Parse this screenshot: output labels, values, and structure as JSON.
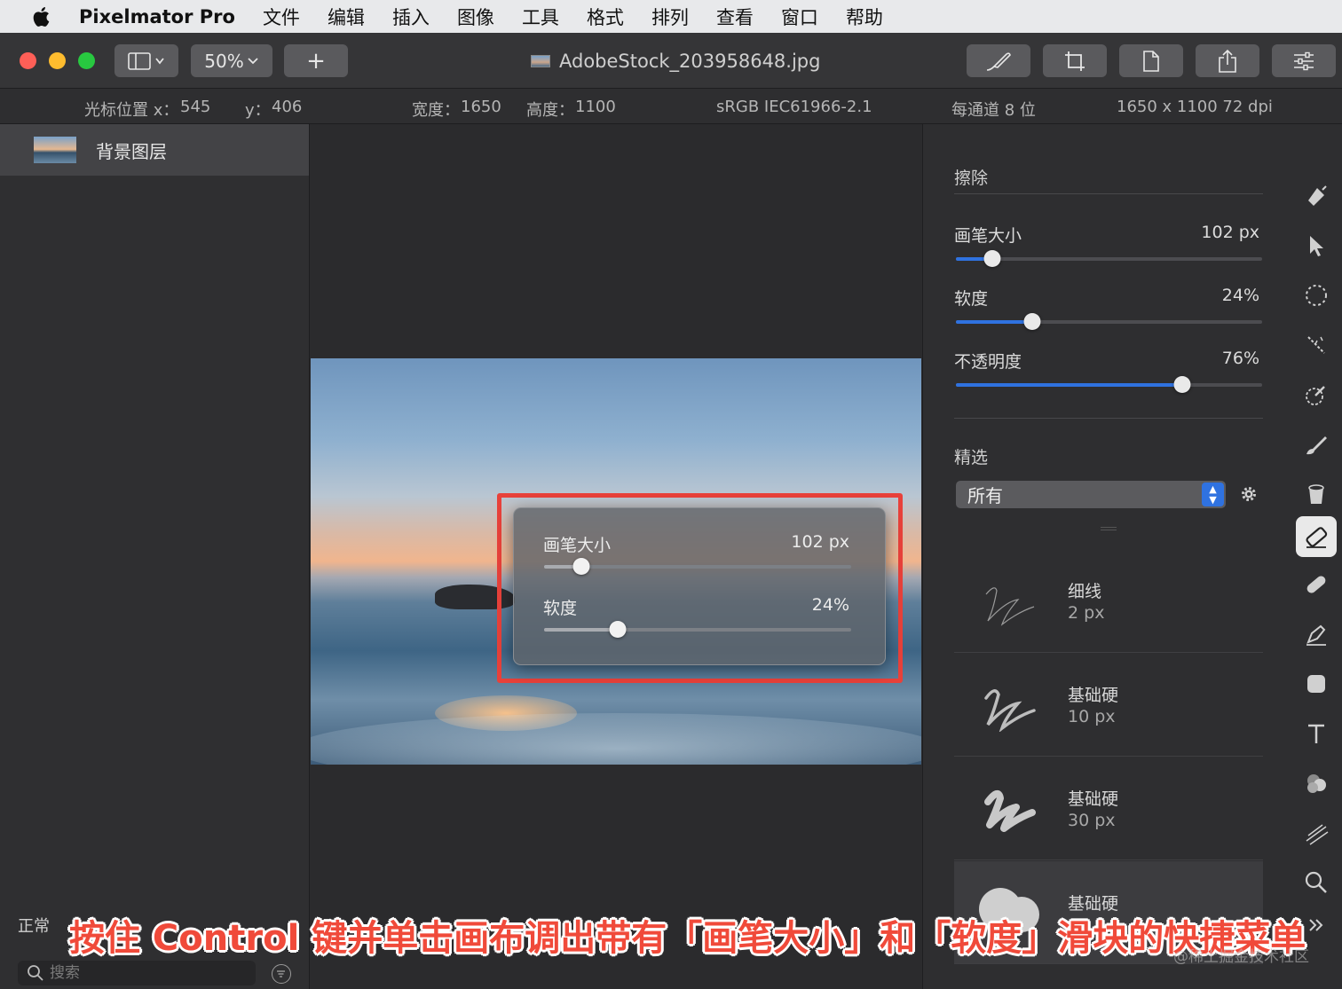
{
  "menubar": {
    "app_name": "Pixelmator Pro",
    "items": [
      "文件",
      "编辑",
      "插入",
      "图像",
      "工具",
      "格式",
      "排列",
      "查看",
      "窗口",
      "帮助"
    ]
  },
  "toolbar": {
    "zoom": "50%",
    "add_symbol": "+",
    "document_title": "AdobeStock_203958648.jpg"
  },
  "infobar": {
    "cursor_x_label": "光标位置 x：",
    "cursor_x": "545",
    "cursor_y_label": "y：",
    "cursor_y": "406",
    "width_label": "宽度：",
    "width": "1650",
    "height_label": "高度：",
    "height": "1100",
    "color_profile": "sRGB IEC61966-2.1",
    "bit_depth": "每通道 8 位",
    "dimensions_dpi": "1650 x 1100 72 dpi"
  },
  "layers": {
    "items": [
      {
        "name": "背景图层"
      }
    ],
    "blend_mode": "正常",
    "search_placeholder": "搜索"
  },
  "popup": {
    "brush_size_label": "画笔大小",
    "brush_size_value": "102 px",
    "brush_size_fraction": 0.12,
    "softness_label": "软度",
    "softness_value": "24%",
    "softness_fraction": 0.24
  },
  "settings": {
    "section_erase": "擦除",
    "brush_size_label": "画笔大小",
    "brush_size_value": "102 px",
    "brush_size_fraction": 0.12,
    "softness_label": "软度",
    "softness_value": "24%",
    "softness_fraction": 0.25,
    "opacity_label": "不透明度",
    "opacity_value": "76%",
    "opacity_fraction": 0.74,
    "section_filter": "精选",
    "filter_value": "所有",
    "presets": [
      {
        "name": "细线",
        "size": "2 px"
      },
      {
        "name": "基础硬",
        "size": "10 px"
      },
      {
        "name": "基础硬",
        "size": "30 px"
      },
      {
        "name": "基础硬",
        "size": ""
      }
    ]
  },
  "caption": "按住 Control 键并单击画布调出带有「画笔大小」和「软度」滑块的快捷菜单",
  "watermark": "@稀土掘金技术社区",
  "colors": {
    "accent_blue": "#2f72e0",
    "highlight_red": "#e8413a",
    "traffic_red": "#fe5f57",
    "traffic_yellow": "#febc2e",
    "traffic_green": "#28c840"
  }
}
